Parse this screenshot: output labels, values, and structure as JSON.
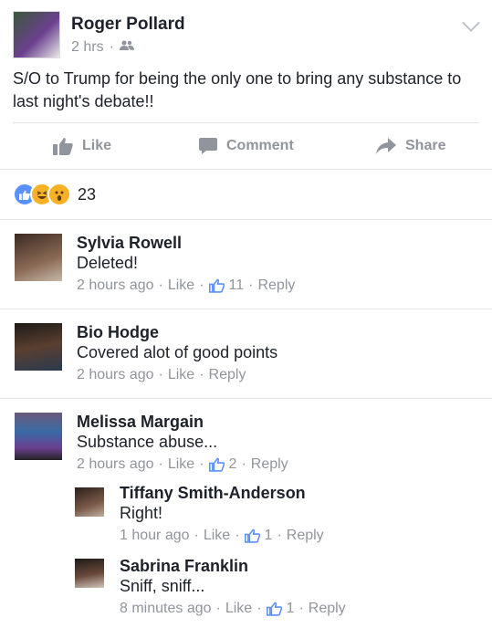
{
  "post": {
    "author": "Roger Pollard",
    "time": "2 hrs",
    "audience_icon": "friends-icon",
    "text": "S/O to Trump for being the only one to bring any substance to last night's debate!!"
  },
  "actions": {
    "like": "Like",
    "comment": "Comment",
    "share": "Share"
  },
  "reactions": {
    "types": [
      "like",
      "haha",
      "wow"
    ],
    "count": "23"
  },
  "comments": [
    {
      "name": "Sylvia Rowell",
      "text": "Deleted!",
      "time": "2 hours ago",
      "like": "Like",
      "likes": "11",
      "reply": "Reply"
    },
    {
      "name": "Bio Hodge",
      "text": "Covered alot of good points",
      "time": "2 hours ago",
      "like": "Like",
      "reply": "Reply"
    },
    {
      "name": "Melissa Margain",
      "text": "Substance abuse...",
      "time": "2 hours ago",
      "like": "Like",
      "likes": "2",
      "reply": "Reply"
    },
    {
      "name": "Tiffany Smith-Anderson",
      "text": "Right!",
      "time": "1 hour ago",
      "like": "Like",
      "likes": "1",
      "reply": "Reply"
    },
    {
      "name": "Sabrina Franklin",
      "text": "Sniff, sniff...",
      "time": "8 minutes ago",
      "like": "Like",
      "likes": "1",
      "reply": "Reply"
    }
  ],
  "colors": {
    "text": "#1d2129",
    "meta": "#90949c",
    "like_blue": "#5890ff",
    "divider": "#e5e5e5"
  }
}
